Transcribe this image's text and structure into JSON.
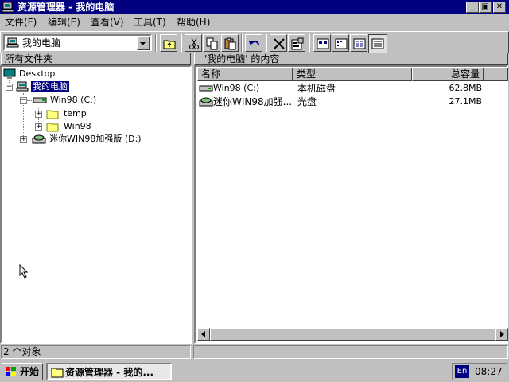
{
  "window": {
    "title": "资源管理器 - 我的电脑",
    "caption_buttons": {
      "minimize": "_",
      "maximize": "▣",
      "close": "✕"
    }
  },
  "menu": [
    {
      "label": "文件(F)"
    },
    {
      "label": "编辑(E)"
    },
    {
      "label": "查看(V)"
    },
    {
      "label": "工具(T)"
    },
    {
      "label": "帮助(H)"
    }
  ],
  "toolbar": {
    "address_value": "我的电脑",
    "buttons": [
      "up-one-level",
      "cut",
      "copy",
      "paste",
      "undo",
      "delete",
      "properties",
      "large-icons",
      "small-icons",
      "list",
      "details"
    ],
    "pressed_button": "details"
  },
  "left_pane": {
    "header": "所有文件夹",
    "tree": {
      "desktop": "Desktop",
      "my_computer": "我的电脑",
      "drive_c": "Win98 (C:)",
      "folder_temp": "temp",
      "folder_win98": "Win98",
      "drive_d": "迷你WIN98加强版 (D:)"
    }
  },
  "right_pane": {
    "header": "'我的电脑' 的内容",
    "columns": {
      "name": "名称",
      "type": "类型",
      "capacity": "总容量"
    },
    "rows": [
      {
        "name": "Win98 (C:)",
        "type": "本机磁盘",
        "capacity": "62.8MB"
      },
      {
        "name": "迷你WIN98加强...",
        "type": "光盘",
        "capacity": "27.1MB"
      }
    ]
  },
  "status": {
    "objects": "2 个对象"
  },
  "taskbar": {
    "start_label": "开始",
    "task_label": "资源管理器 - 我的...",
    "lang": "En",
    "clock": "08:27"
  },
  "colors": {
    "titlebar": "#000080",
    "face": "#c0c0c0",
    "selection": "#000080"
  }
}
